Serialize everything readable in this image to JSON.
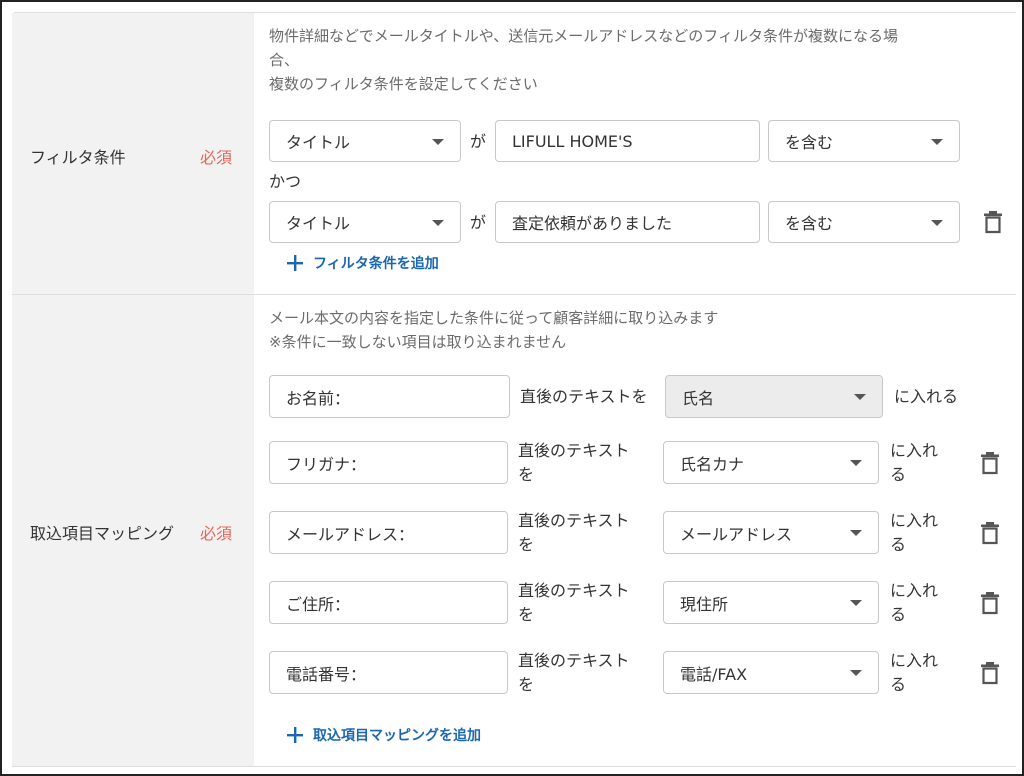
{
  "filter_section": {
    "label": "フィルタ条件",
    "required": "必須",
    "note_line1": "物件詳細などでメールタイトルや、送信元メールアドレスなどのフィルタ条件が複数になる場",
    "note_line2": "合、",
    "note_line3": "複数のフィルタ条件を設定してください",
    "conditions": [
      {
        "field": "タイトル",
        "connector": "が",
        "value": "LIFULL HOME'S",
        "operator": "を含む"
      },
      {
        "field": "タイトル",
        "connector": "が",
        "value": "査定依頼がありました",
        "operator": "を含む"
      }
    ],
    "and_label": "かつ",
    "add_label": "フィルタ条件を追加"
  },
  "mapping_section": {
    "label": "取込項目マッピング",
    "required": "必須",
    "note_line1": "メール本文の内容を指定した条件に従って顧客詳細に取り込みます",
    "note_line2": "※条件に一致しない項目は取り込まれません",
    "rows": [
      {
        "source": "お名前：",
        "mid_text": "直後のテキストを",
        "target": "氏名",
        "end_text": "に入れる"
      },
      {
        "source": "フリガナ：",
        "mid_a": "直後のテキスト",
        "mid_b": "を",
        "target": "氏名カナ",
        "end_a": "に入れ",
        "end_b": "る"
      },
      {
        "source": "メールアドレス：",
        "mid_a": "直後のテキスト",
        "mid_b": "を",
        "target": "メールアドレス",
        "end_a": "に入れ",
        "end_b": "る"
      },
      {
        "source": "ご住所：",
        "mid_a": "直後のテキスト",
        "mid_b": "を",
        "target": "現住所",
        "end_a": "に入れ",
        "end_b": "る"
      },
      {
        "source": "電話番号：",
        "mid_a": "直後のテキスト",
        "mid_b": "を",
        "target": "電話/FAX",
        "end_a": "に入れ",
        "end_b": "る"
      }
    ],
    "add_label": "取込項目マッピングを追加"
  },
  "colors": {
    "required": "#e8665a",
    "link": "#1a66b0",
    "label_bg": "#f2f2f2"
  },
  "icons": {
    "delete": "trash-icon",
    "add": "plus-icon",
    "dropdown": "chevron-down-icon"
  }
}
